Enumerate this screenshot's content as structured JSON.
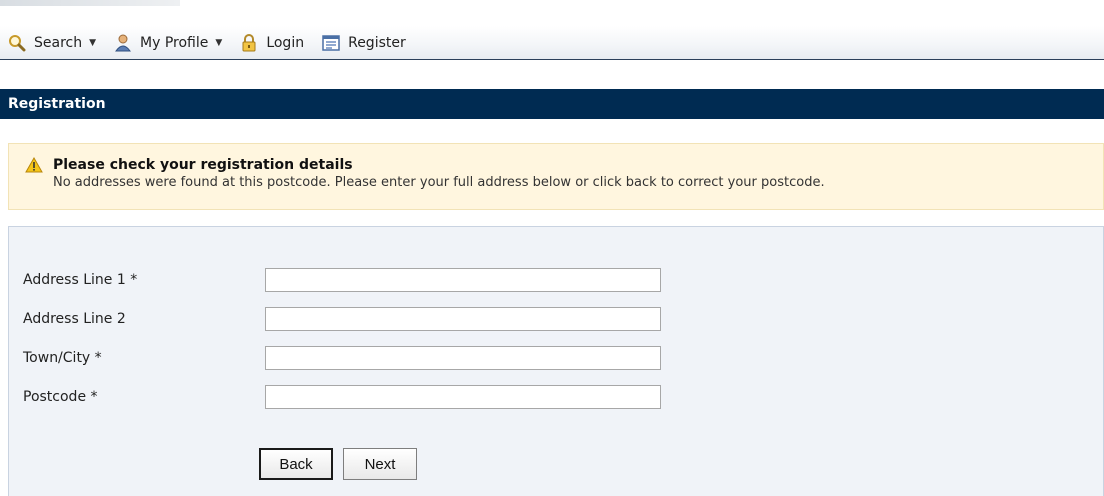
{
  "toolbar": {
    "search_label": "Search",
    "profile_label": "My Profile",
    "login_label": "Login",
    "register_label": "Register",
    "icons": {
      "search": "magnifier-icon",
      "profile": "user-icon",
      "login": "lock-icon",
      "register": "form-icon"
    }
  },
  "section": {
    "title": "Registration"
  },
  "alert": {
    "title": "Please check your registration details",
    "message": "No addresses were found at this postcode. Please enter your full address below or click back to correct your postcode."
  },
  "form": {
    "fields": [
      {
        "label": "Address Line 1 *",
        "value": ""
      },
      {
        "label": "Address Line 2",
        "value": ""
      },
      {
        "label": "Town/City *",
        "value": ""
      },
      {
        "label": "Postcode *",
        "value": ""
      }
    ],
    "back_label": "Back",
    "next_label": "Next"
  },
  "colors": {
    "header_bar": "#002b52",
    "alert_bg": "#fff6df",
    "panel_bg": "#f0f3f8"
  }
}
